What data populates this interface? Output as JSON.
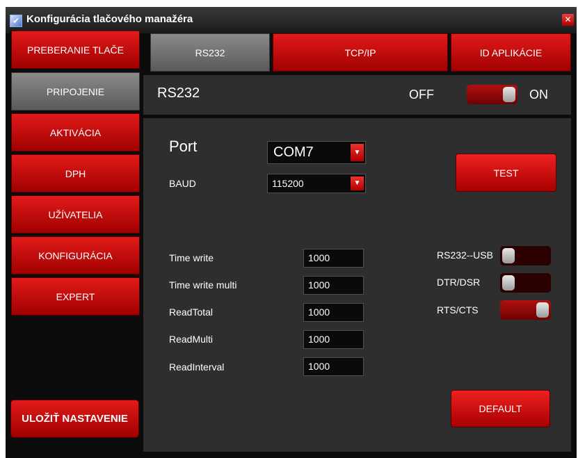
{
  "window": {
    "title": "Konfigurácia tlačového manažéra"
  },
  "sidebar": {
    "items": [
      {
        "label": "PREBERANIE TLAČE"
      },
      {
        "label": "PRIPOJENIE"
      },
      {
        "label": "AKTIVÁCIA"
      },
      {
        "label": "DPH"
      },
      {
        "label": "UŽÍVATELIA"
      },
      {
        "label": "KONFIGURÁCIA"
      },
      {
        "label": "EXPERT"
      }
    ],
    "active": "PRIPOJENIE",
    "save_label": "ULOŽIŤ NASTAVENIE"
  },
  "tabs": [
    {
      "label": "RS232"
    },
    {
      "label": "TCP/IP"
    },
    {
      "label": "ID APLIKÁCIE"
    }
  ],
  "active_tab": "RS232",
  "header": {
    "title": "RS232",
    "off_label": "OFF",
    "on_label": "ON",
    "enabled": true
  },
  "port": {
    "label": "Port",
    "value": "COM7"
  },
  "baud": {
    "label": "BAUD",
    "value": "115200"
  },
  "test_label": "TEST",
  "timings": [
    {
      "label": "Time write",
      "value": "1000"
    },
    {
      "label": "Time write multi",
      "value": "1000"
    },
    {
      "label": "ReadTotal",
      "value": "1000"
    },
    {
      "label": "ReadMulti",
      "value": "1000"
    },
    {
      "label": "ReadInterval",
      "value": "1000"
    }
  ],
  "switches": [
    {
      "label": "RS232--USB",
      "on": false
    },
    {
      "label": "DTR/DSR",
      "on": false
    },
    {
      "label": "RTS/CTS",
      "on": true
    }
  ],
  "default_label": "DEFAULT",
  "colors": {
    "accent": "#d01010",
    "background": "#2e2e2e",
    "frame": "#0c0c0c"
  }
}
